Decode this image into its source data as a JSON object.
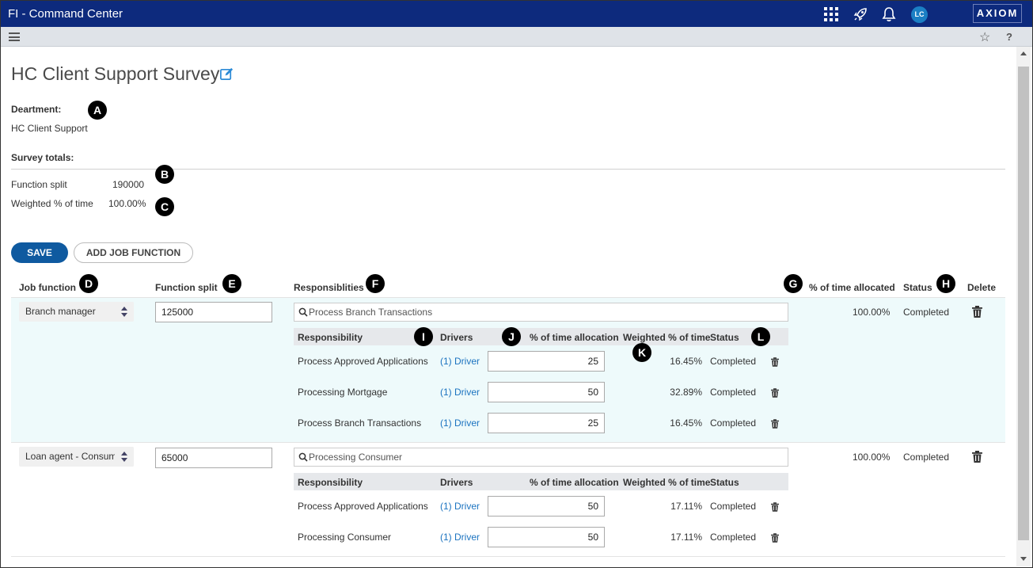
{
  "app": {
    "title": "FI - Command Center",
    "avatar_initials": "LC",
    "logo": "AXIOM"
  },
  "page": {
    "title": "HC Client Support Survey"
  },
  "department": {
    "label": "Deartment:",
    "value": "HC Client Support"
  },
  "survey_totals": {
    "label": "Survey totals:",
    "function_split_label": "Function split",
    "function_split_value": "190000",
    "weighted_label": "Weighted % of time",
    "weighted_value": "100.00%"
  },
  "buttons": {
    "save": "SAVE",
    "add_job_function": "ADD JOB FUNCTION"
  },
  "columns": {
    "job_function": "Job function",
    "function_split": "Function split",
    "responsibilities": "Responsiblities",
    "pct_allocated": "% of time allocated",
    "status": "Status",
    "delete": "Delete"
  },
  "sub_columns": {
    "responsibility": "Responsibility",
    "drivers": "Drivers",
    "pct_allocation": "% of time allocation",
    "weighted": "Weighted % of time",
    "status": "Status"
  },
  "markers": [
    "A",
    "B",
    "C",
    "D",
    "E",
    "F",
    "G",
    "H",
    "I",
    "J",
    "K",
    "L"
  ],
  "job_functions": [
    {
      "name": "Branch manager",
      "split": "125000",
      "search": "Process Branch Transactions",
      "pct_allocated": "100.00%",
      "status": "Completed",
      "rows": [
        {
          "responsibility": "Process Approved Applications",
          "drivers": "(1) Driver",
          "allocation": "25",
          "weighted": "16.45%",
          "status": "Completed"
        },
        {
          "responsibility": "Processing Mortgage",
          "drivers": "(1) Driver",
          "allocation": "50",
          "weighted": "32.89%",
          "status": "Completed"
        },
        {
          "responsibility": "Process Branch Transactions",
          "drivers": "(1) Driver",
          "allocation": "25",
          "weighted": "16.45%",
          "status": "Completed"
        }
      ]
    },
    {
      "name": "Loan agent - Consumer",
      "split": "65000",
      "search": "Processing Consumer",
      "pct_allocated": "100.00%",
      "status": "Completed",
      "rows": [
        {
          "responsibility": "Process Approved Applications",
          "drivers": "(1) Driver",
          "allocation": "50",
          "weighted": "17.11%",
          "status": "Completed"
        },
        {
          "responsibility": "Processing Consumer",
          "drivers": "(1) Driver",
          "allocation": "50",
          "weighted": "17.11%",
          "status": "Completed"
        }
      ]
    }
  ]
}
